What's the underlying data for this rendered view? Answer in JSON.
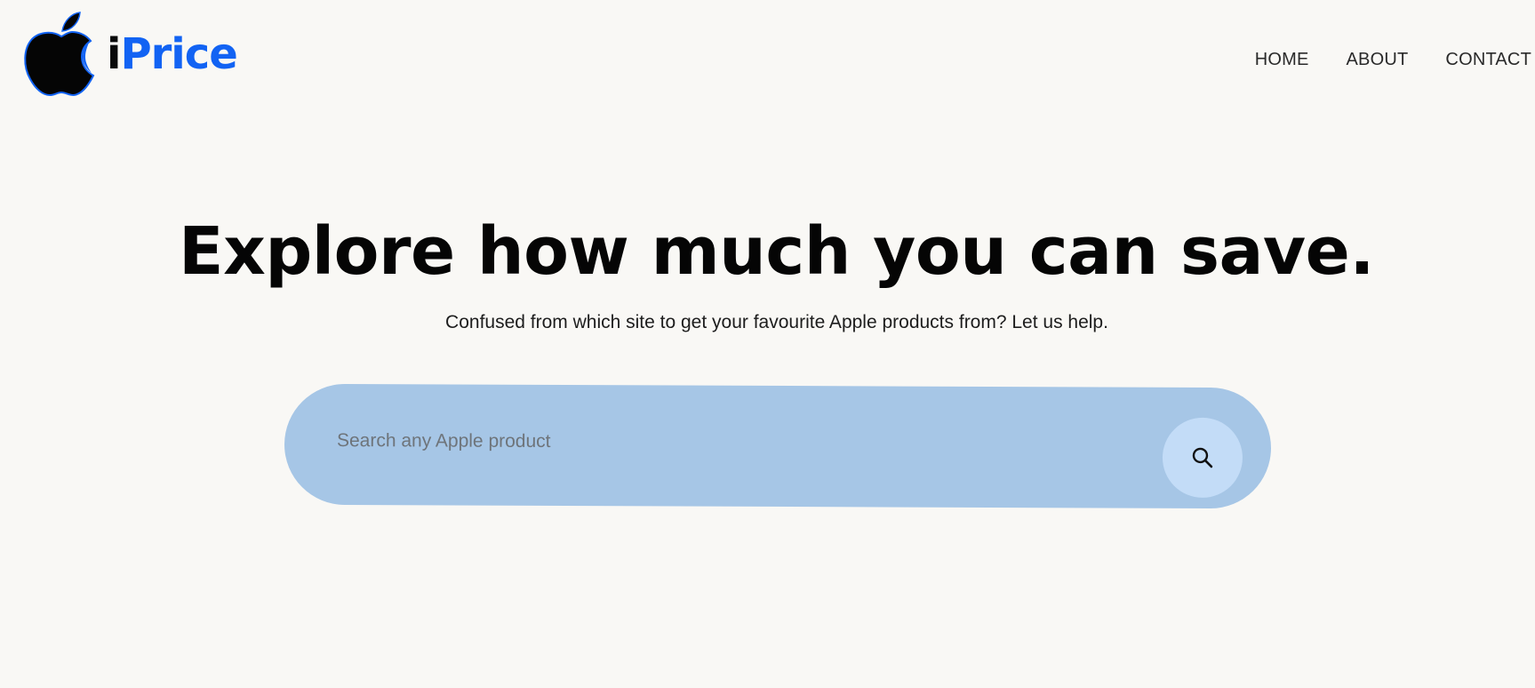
{
  "brand": {
    "logo_letter": "i",
    "logo_word": "Price",
    "brand_color": "#1263f3",
    "logo_icon": "apple-icon"
  },
  "nav": {
    "items": [
      {
        "label": "HOME"
      },
      {
        "label": "ABOUT"
      },
      {
        "label": "CONTACT"
      }
    ]
  },
  "hero": {
    "title": "Explore how much you can save.",
    "subtitle": "Confused from which site to get your favourite Apple products from? Let us help."
  },
  "search": {
    "placeholder": "Search any Apple product",
    "value": "",
    "button_icon": "search-icon",
    "bar_color": "#a6c6e6",
    "button_color": "#c3dcf7"
  },
  "page": {
    "background": "#f9f8f5"
  }
}
